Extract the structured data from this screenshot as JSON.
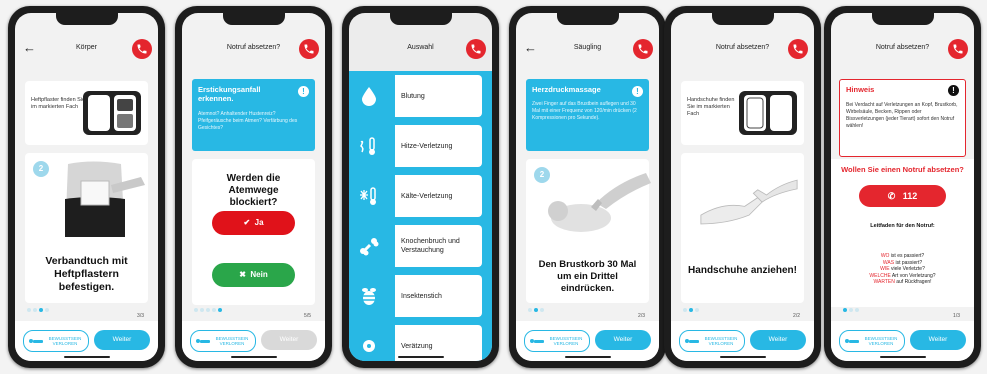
{
  "common": {
    "bewusst_label": "BEWUSSTSEIN VERLOREN",
    "weiter_label": "Weiter"
  },
  "phone1": {
    "title": "Körper",
    "hint_text": "Heftpflaster finden Sie im markierten Fach",
    "step": "2",
    "caption": "Verbandtuch mit Heftpflastern befestigen.",
    "page": "3/3"
  },
  "phone2": {
    "title": "Notruf absetzen?",
    "box_title": "Erstickungsanfall erkennen.",
    "box_body": "Atemnot? Anhaltender Hustenreiz? Pfeifgeräusche beim Atmen? Verfärbung des Gesichtes?",
    "question": "Werden die Atemwege blockiert?",
    "yes_label": "Ja",
    "no_label": "Nein",
    "page": "5/5"
  },
  "phone3": {
    "title": "Auswahl",
    "items": [
      {
        "label": "Blutung",
        "icon": "drop-icon"
      },
      {
        "label": "Hitze-Verletzung",
        "icon": "heat-thermometer-icon"
      },
      {
        "label": "Kälte-Verletzung",
        "icon": "cold-thermometer-icon"
      },
      {
        "label": "Knochenbruch und Verstauchung",
        "icon": "bone-icon"
      },
      {
        "label": "Insektenstich",
        "icon": "bee-icon"
      },
      {
        "label": "Verätzung",
        "icon": "chemical-icon"
      }
    ]
  },
  "phone4": {
    "title": "Säugling",
    "box_title": "Herzdruckmassage",
    "box_body": "Zwei Finger auf das Brustbein auflegen und 30 Mal mit einer Frequenz von 120/min drücken (2 Kompressionen pro Sekunde).",
    "step": "2",
    "caption": "Den Brustkorb 30 Mal um ein Drittel eindrücken.",
    "page": "2/3"
  },
  "phone5": {
    "title": "Notruf absetzen?",
    "hint_text": "Handschuhe finden Sie im markierten Fach",
    "caption": "Handschuhe anziehen!",
    "page": "2/2"
  },
  "phone6": {
    "title": "Notruf absetzen?",
    "hint_title": "Hinweis",
    "hint_body": "Bei Verdacht auf Verletzungen an Kopf, Brustkorb, Wirbelsäule, Becken, Rippen oder Bissverletzungen (jeder Tierart) sofort den Notruf wählen!",
    "question": "Wollen Sie einen Notruf absetzen?",
    "call_number": "112",
    "guide_title": "Leitfaden für den Notruf:",
    "guide_lines": [
      {
        "w": "WO",
        "rest": " ist es passiert?"
      },
      {
        "w": "WAS",
        "rest": " ist passiert?"
      },
      {
        "w": "WIE",
        "rest": " viele Verletzte?"
      },
      {
        "w": "WELCHE",
        "rest": " Art von Verletzung?"
      },
      {
        "w": "WARTEN",
        "rest": " auf Rückfragen!"
      }
    ],
    "page": "1/3"
  },
  "colors": {
    "accent_blue": "#28b8e4",
    "emergency_red": "#e4262e",
    "yes_red": "#e0121a",
    "no_green": "#2aa64a"
  }
}
